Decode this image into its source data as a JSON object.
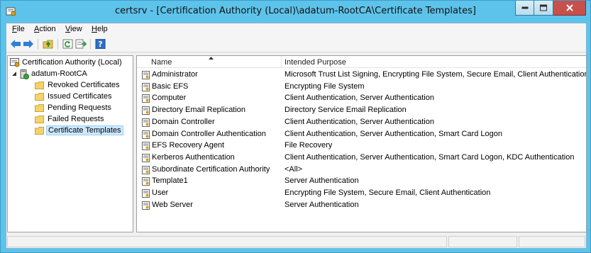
{
  "window": {
    "title": "certsrv - [Certification Authority (Local)\\adatum-RootCA\\Certificate Templates]"
  },
  "menu": [
    {
      "accel": "F",
      "rest": "ile"
    },
    {
      "accel": "A",
      "rest": "ction"
    },
    {
      "accel": "V",
      "rest": "iew"
    },
    {
      "accel": "H",
      "rest": "elp"
    }
  ],
  "toolbar": {
    "buttons": [
      "back-arrow-icon",
      "forward-arrow-icon",
      "up-folder-icon",
      "refresh-icon",
      "export-list-icon",
      "help-icon"
    ]
  },
  "tree": {
    "root": "Certification Authority (Local)",
    "ca": "adatum-RootCA",
    "folders": [
      "Revoked Certificates",
      "Issued Certificates",
      "Pending Requests",
      "Failed Requests",
      "Certificate Templates"
    ],
    "selected": "Certificate Templates"
  },
  "list": {
    "columns": [
      "Name",
      "Intended Purpose"
    ],
    "rows": [
      {
        "name": "Administrator",
        "purpose": "Microsoft Trust List Signing, Encrypting File System, Secure Email, Client Authentication"
      },
      {
        "name": "Basic EFS",
        "purpose": "Encrypting File System"
      },
      {
        "name": "Computer",
        "purpose": "Client Authentication, Server Authentication"
      },
      {
        "name": "Directory Email Replication",
        "purpose": "Directory Service Email Replication"
      },
      {
        "name": "Domain Controller",
        "purpose": "Client Authentication, Server Authentication"
      },
      {
        "name": "Domain Controller Authentication",
        "purpose": "Client Authentication, Server Authentication, Smart Card Logon"
      },
      {
        "name": "EFS Recovery Agent",
        "purpose": "File Recovery"
      },
      {
        "name": "Kerberos Authentication",
        "purpose": "Client Authentication, Server Authentication, Smart Card Logon, KDC Authentication"
      },
      {
        "name": "Subordinate Certification Authority",
        "purpose": "<All>"
      },
      {
        "name": "Template1",
        "purpose": "Server Authentication"
      },
      {
        "name": "User",
        "purpose": "Encrypting File System, Secure Email, Client Authentication"
      },
      {
        "name": "Web Server",
        "purpose": "Server Authentication"
      }
    ]
  },
  "colors": {
    "frame": "#5ec3ea",
    "close": "#c7504d",
    "folder": "#f5d36b",
    "selection": "#cce8ff"
  }
}
